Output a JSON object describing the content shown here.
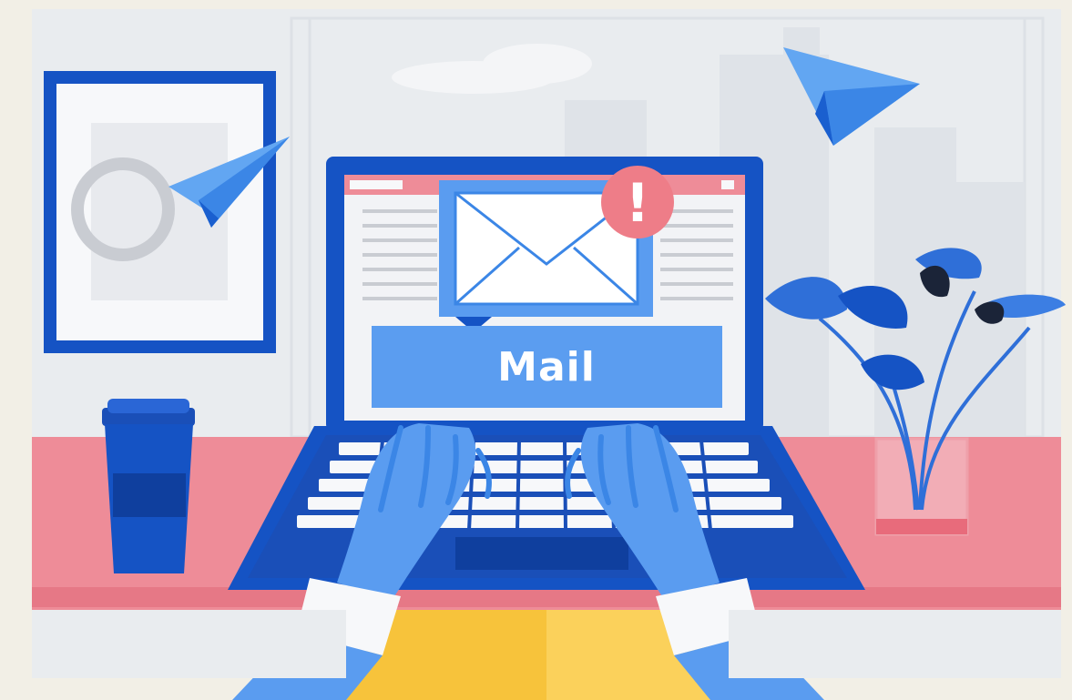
{
  "illustration": {
    "mail_label": "Mail",
    "alert_symbol": "!",
    "icons": [
      "paper-plane-icon",
      "envelope-icon",
      "alert-badge-icon",
      "coffee-cup-icon",
      "plant-icon"
    ],
    "colors": {
      "background": "#f2efe6",
      "wall": "#e9ecef",
      "desk": "#ee8c98",
      "laptop_blue": "#1553c4",
      "light_blue": "#5a9cf0",
      "mail_bar": "#5b9df0",
      "alert_pink": "#ee7d88",
      "chair_yellow": "#f7c33b"
    }
  }
}
